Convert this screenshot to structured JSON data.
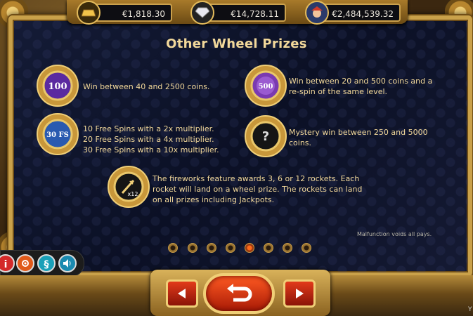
{
  "balances": {
    "coins": "€1,818.30",
    "diamond": "€14,728.11",
    "jackpot": "€2,484,539.32"
  },
  "page_title": "Other Wheel Prizes",
  "prizes": [
    {
      "badge": "100",
      "text_lines": [
        "Win between 40 and 2500 coins."
      ]
    },
    {
      "badge": "500",
      "text_lines": [
        "Win between 20 and 500 coins and a",
        "re-spin of the same level."
      ]
    },
    {
      "badge": "30 FS",
      "text_lines": [
        "10 Free Spins with a 2x multiplier.",
        "20 Free Spins with a 4x multiplier.",
        "30 Free Spins with a 10x multiplier."
      ]
    },
    {
      "badge": "?",
      "text_lines": [
        "Mystery win between 250 and 5000",
        "coins."
      ]
    },
    {
      "badge": "x12",
      "text_lines": [
        "The fireworks feature awards 3, 6 or 12 rockets. Each",
        "rocket will land on a wheel prize. The rockets can land",
        "on all prizes including Jackpots."
      ]
    }
  ],
  "disclaimer": "Malfunction voids all pays.",
  "pagination": {
    "total": 8,
    "current": 5
  },
  "side_buttons": [
    "info-icon",
    "gear-icon",
    "rules-icon",
    "sound-icon"
  ],
  "side_labels": {
    "info": "i",
    "rules": "§"
  },
  "corner_text": "Y",
  "colors": {
    "accent_gold": "#f2d89a",
    "panel_bg": "#0b1025",
    "nav_red": "#e23a1a"
  }
}
